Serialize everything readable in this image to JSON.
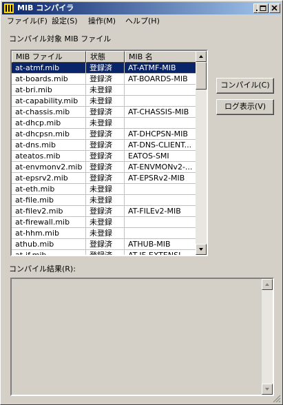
{
  "window": {
    "title": "MIB コンパイラ"
  },
  "menu": [
    "ファイル(F)",
    "設定(S)",
    "操作(M)",
    "ヘルプ(H)"
  ],
  "labels": {
    "files": "コンパイル対象 MIB ファイル",
    "result": "コンパイル結果(R):"
  },
  "columns": [
    "MIB ファイル",
    "状態",
    "MIB 名"
  ],
  "rows": [
    {
      "file": "at-atmf.mib",
      "status": "登録済",
      "name": "AT-ATMF-MIB"
    },
    {
      "file": "at-boards.mib",
      "status": "登録済",
      "name": "AT-BOARDS-MIB"
    },
    {
      "file": "at-bri.mib",
      "status": "未登録",
      "name": ""
    },
    {
      "file": "at-capability.mib",
      "status": "未登録",
      "name": ""
    },
    {
      "file": "at-chassis.mib",
      "status": "登録済",
      "name": "AT-CHASSIS-MIB"
    },
    {
      "file": "at-dhcp.mib",
      "status": "未登録",
      "name": ""
    },
    {
      "file": "at-dhcpsn.mib",
      "status": "登録済",
      "name": "AT-DHCPSN-MIB"
    },
    {
      "file": "at-dns.mib",
      "status": "登録済",
      "name": "AT-DNS-CLIENT..."
    },
    {
      "file": "ateatos.mib",
      "status": "登録済",
      "name": "EATOS-SMI"
    },
    {
      "file": "at-envmonv2.mib",
      "status": "登録済",
      "name": "AT-ENVMONv2-..."
    },
    {
      "file": "at-epsrv2.mib",
      "status": "登録済",
      "name": "AT-EPSRv2-MIB"
    },
    {
      "file": "at-eth.mib",
      "status": "未登録",
      "name": ""
    },
    {
      "file": "at-file.mib",
      "status": "未登録",
      "name": ""
    },
    {
      "file": "at-filev2.mib",
      "status": "登録済",
      "name": "AT-FILEv2-MIB"
    },
    {
      "file": "at-firewall.mib",
      "status": "未登録",
      "name": ""
    },
    {
      "file": "at-hhm.mib",
      "status": "未登録",
      "name": ""
    },
    {
      "file": "athub.mib",
      "status": "登録済",
      "name": "ATHUB-MIB"
    },
    {
      "file": "at-if.mib",
      "status": "登録済",
      "name": "AT-IF-EXTENSI..."
    }
  ],
  "selected_index": 0,
  "buttons": {
    "compile": "コンパイル(C)",
    "log": "ログ表示(V)"
  },
  "colors": {
    "titlebar": "#0a246a",
    "selection": "#0a246a",
    "face": "#d4d0c8"
  }
}
